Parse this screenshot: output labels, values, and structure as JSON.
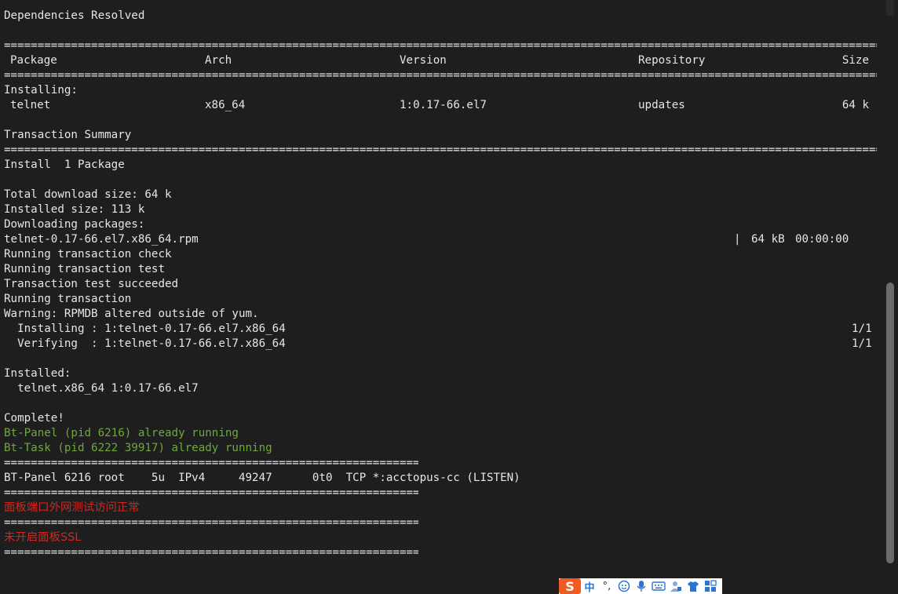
{
  "terminal": {
    "heading": "Dependencies Resolved",
    "separator": "================================================================================================================================================================================================================================================================================",
    "short_separator": "==================================================================",
    "table": {
      "headers": [
        "Package",
        "Arch",
        "Version",
        "Repository",
        "Size"
      ],
      "group_label": "Installing:",
      "rows": [
        [
          "telnet",
          "x86_64",
          "1:0.17-66.el7",
          "updates",
          "64 k"
        ]
      ]
    },
    "summary_title": "Transaction Summary",
    "install_line": "Install  1 Package",
    "total_download": "Total download size: 64 k",
    "installed_size": "Installed size: 113 k",
    "downloading": "Downloading packages:",
    "download_file": "telnet-0.17-66.el7.x86_64.rpm",
    "download_bar": "|",
    "download_size": "64 kB",
    "download_time": "00:00:00",
    "steps": [
      "Running transaction check",
      "Running transaction test",
      "Transaction test succeeded",
      "Running transaction",
      "Warning: RPMDB altered outside of yum."
    ],
    "actions": [
      {
        "text": "  Installing : 1:telnet-0.17-66.el7.x86_64",
        "count": "1/1"
      },
      {
        "text": "  Verifying  : 1:telnet-0.17-66.el7.x86_64",
        "count": "1/1"
      }
    ],
    "installed_label": "Installed:",
    "installed_pkg": "  telnet.x86_64 1:0.17-66.el7",
    "complete": "Complete!",
    "bt_panel": "Bt-Panel (pid 6216) already running",
    "bt_task": "Bt-Task (pid 6222 39917) already running",
    "lsof_line": "BT-Panel 6216 root    5u  IPv4     49247      0t0  TCP *:acctopus-cc (LISTEN)",
    "msg_port": "面板端口外网测试访问正常",
    "msg_ssl": "未开启面板SSL",
    "colors": {
      "background": "#1e1e1e",
      "text": "#e6e6e6",
      "green": "#6fa83c",
      "red": "#d3261d"
    }
  },
  "ime_toolbar": {
    "logo": "S",
    "lang": "中",
    "punct": "°,",
    "icons": [
      "emoji-icon",
      "microphone-icon",
      "keyboard-icon",
      "user-icon",
      "skin-icon",
      "grid-icon"
    ]
  }
}
